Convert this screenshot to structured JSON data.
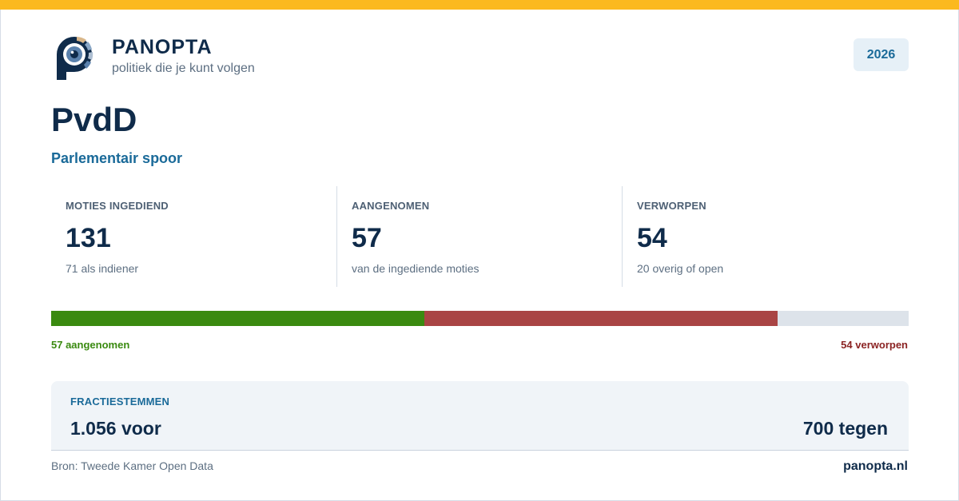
{
  "colors": {
    "top_bar": "#fbb91f",
    "navy": "#0f2b4a",
    "accent_blue": "#1a6a99",
    "adopted": "#3a8a10",
    "rejected": "#a94444",
    "remaining": "#dde3ea"
  },
  "brand": {
    "logo_icon": "panopta-eye-logo-icon",
    "name": "PANOPTA",
    "tagline": "politiek die je kunt volgen"
  },
  "year": "2026",
  "party": "PvdD",
  "subtitle": "Parlementair spoor",
  "stats": [
    {
      "label": "MOTIES INGEDIEND",
      "value": "131",
      "note": "71 als indiener"
    },
    {
      "label": "AANGENOMEN",
      "value": "57",
      "note": "van de ingediende moties"
    },
    {
      "label": "VERWORPEN",
      "value": "54",
      "note": "20 overig of open"
    }
  ],
  "progress": {
    "total": 131,
    "adopted": 57,
    "rejected": 54,
    "other": 20,
    "adopted_label": "57 aangenomen",
    "rejected_label": "54 verworpen"
  },
  "votes": {
    "label": "FRACTIESTEMMEN",
    "for_text": "1.056 voor",
    "against_text": "700 tegen"
  },
  "footer": {
    "source": "Bron: Tweede Kamer Open Data",
    "site": "panopta.nl"
  }
}
